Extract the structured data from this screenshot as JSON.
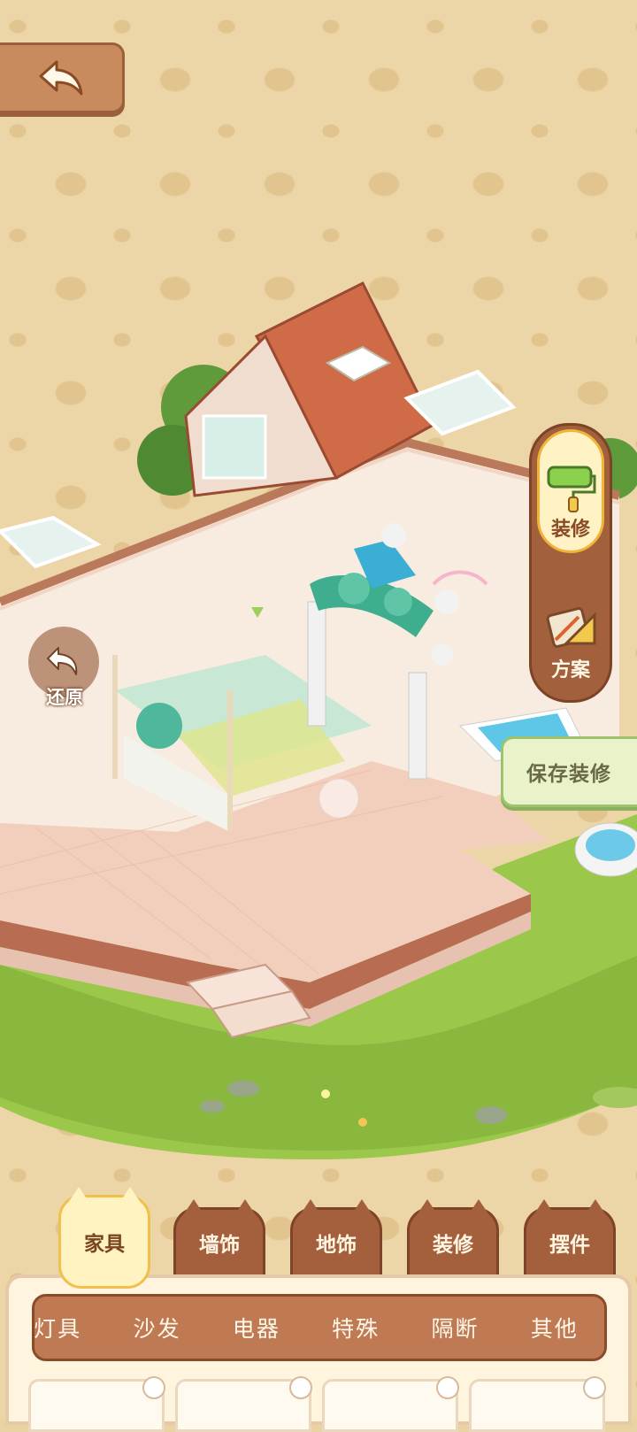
{
  "header": {
    "back_button": "back-arrow-icon"
  },
  "side_menu": {
    "decorate_label": "装修",
    "plan_label": "方案"
  },
  "reset_label": "还原",
  "save_label": "保存装修",
  "tabs": [
    {
      "label": "家具",
      "active": true
    },
    {
      "label": "墙饰",
      "active": false
    },
    {
      "label": "地饰",
      "active": false
    },
    {
      "label": "装修",
      "active": false
    },
    {
      "label": "摆件",
      "active": false
    }
  ],
  "subcategories": [
    "灯具",
    "沙发",
    "电器",
    "特殊",
    "隔断",
    "其他"
  ],
  "colors": {
    "wood": "#a45f3c",
    "cream": "#fff3c2",
    "grass": "#8fbf45",
    "tile": "#f0cbb9",
    "save_green": "#9cc46b"
  }
}
